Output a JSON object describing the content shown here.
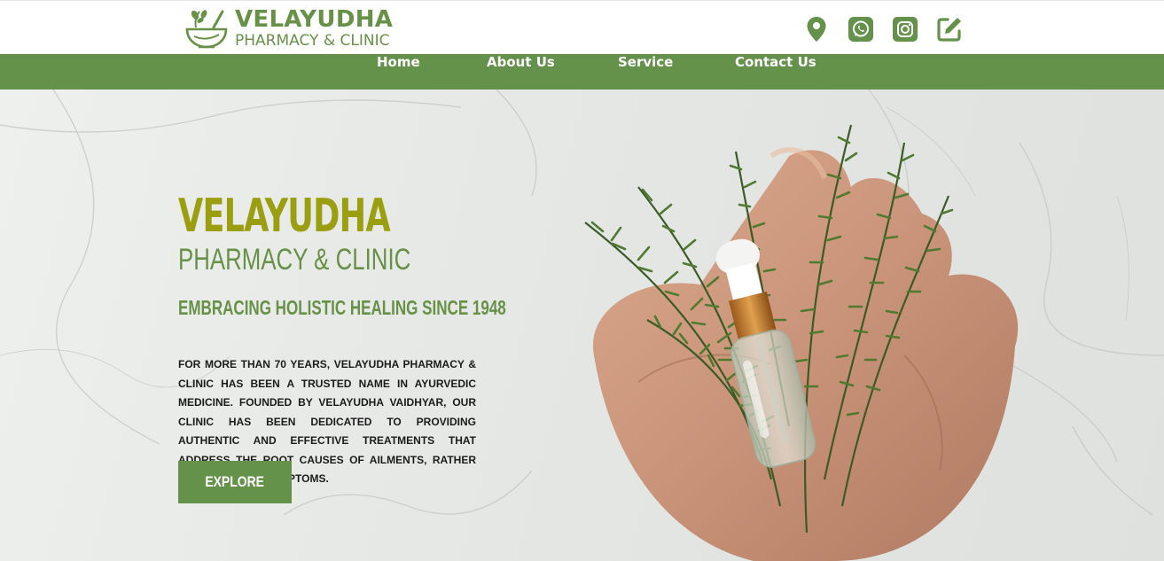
{
  "brand": {
    "name": "VELAYUDHA",
    "tagline": "PHARMACY & CLINIC"
  },
  "social": [
    {
      "icon": "location-pin-icon"
    },
    {
      "icon": "whatsapp-icon"
    },
    {
      "icon": "instagram-icon"
    },
    {
      "icon": "edit-icon"
    }
  ],
  "nav": {
    "home": "Home",
    "about": "About Us",
    "service": "Service",
    "contact": "Contact Us"
  },
  "hero": {
    "title": "VELAYUDHA",
    "subtitle": "PHARMACY & CLINIC",
    "tagline": "EMBRACING HOLISTIC HEALING SINCE 1948",
    "description": "For more than 70 years, Velayudha Pharmacy & Clinic has been a trusted name in Ayurvedic medicine. Founded by Velayudha Vaidhyar, our clinic has been dedicated to providing authentic and effective treatments that address the root causes of ailments, rather than just the symptoms.",
    "button": "EXPLORE"
  },
  "colors": {
    "accent": "#65924a",
    "title_olive": "#9a9e0f",
    "text_dark": "#1b1b1b"
  }
}
